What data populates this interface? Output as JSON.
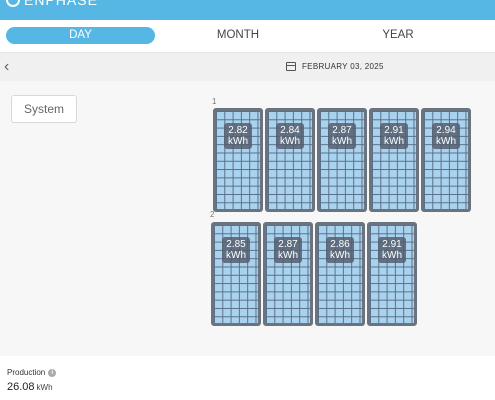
{
  "header": {
    "logo": "ENPHASE"
  },
  "tabs": [
    {
      "label": "DAY",
      "active": true
    },
    {
      "label": "MONTH",
      "active": false
    },
    {
      "label": "YEAR",
      "active": false
    }
  ],
  "date_bar": {
    "date": "FEBRUARY 03, 2025"
  },
  "view": {
    "system_button": "System"
  },
  "array": {
    "rows": [
      {
        "label": "1",
        "panels": [
          {
            "value": "2.82",
            "unit": "kWh"
          },
          {
            "value": "2.84",
            "unit": "kWh"
          },
          {
            "value": "2.87",
            "unit": "kWh"
          },
          {
            "value": "2.91",
            "unit": "kWh"
          },
          {
            "value": "2.94",
            "unit": "kWh"
          }
        ]
      },
      {
        "label": "2",
        "panels": [
          {
            "value": "2.85",
            "unit": "kWh"
          },
          {
            "value": "2.87",
            "unit": "kWh"
          },
          {
            "value": "2.86",
            "unit": "kWh"
          },
          {
            "value": "2.91",
            "unit": "kWh"
          }
        ]
      }
    ]
  },
  "footer": {
    "production_label": "Production",
    "production_value": "26.08",
    "production_unit": "kWh"
  },
  "colors": {
    "accent": "#56b7e4",
    "panel_cell": "#a9d2ee",
    "panel_frame": "#6a7380"
  }
}
